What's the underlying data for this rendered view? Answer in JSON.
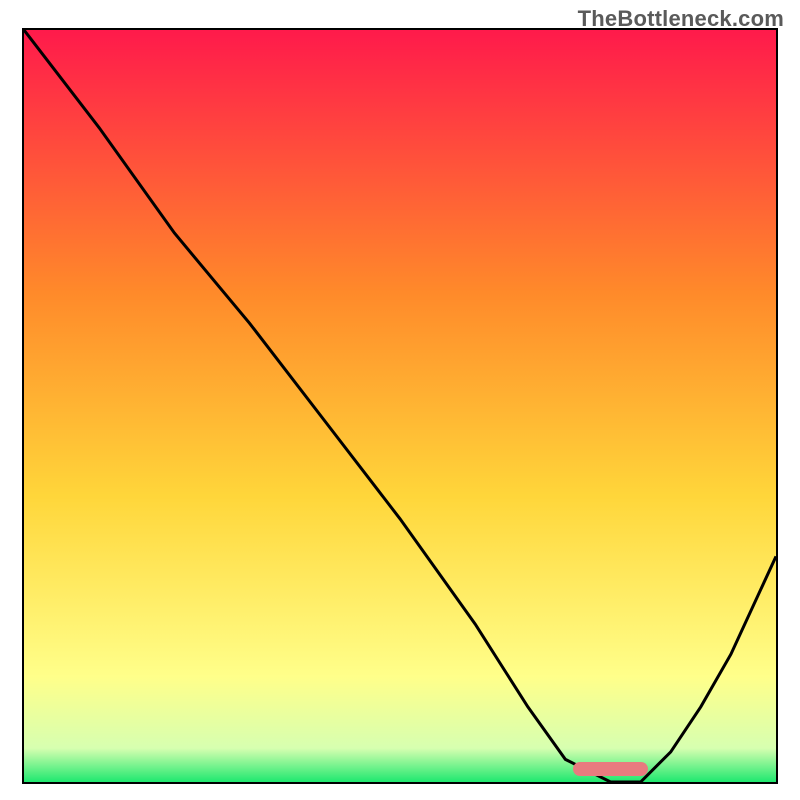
{
  "watermark": "TheBottleneck.com",
  "colors": {
    "gradient_top": "#ff1a4b",
    "gradient_upper_mid": "#ff8a2a",
    "gradient_mid": "#ffd63a",
    "gradient_lower": "#ffff8a",
    "gradient_green_band_top": "#d7ffb0",
    "gradient_bottom": "#1fe86f",
    "curve": "#000000",
    "marker": "#e87b7f",
    "border": "#000000"
  },
  "chart_data": {
    "type": "line",
    "title": "",
    "xlabel": "",
    "ylabel": "",
    "xlim": [
      0,
      100
    ],
    "ylim": [
      0,
      100
    ],
    "series": [
      {
        "name": "bottleneck-curve",
        "x": [
          0,
          10,
          20,
          25,
          30,
          40,
          50,
          60,
          67,
          72,
          78,
          82,
          86,
          90,
          94,
          100
        ],
        "values": [
          100,
          87,
          73,
          67,
          61,
          48,
          35,
          21,
          10,
          3,
          0,
          0,
          4,
          10,
          17,
          30
        ]
      }
    ],
    "highlight_segment": {
      "x_start": 73,
      "x_end": 83,
      "y": 0
    }
  }
}
